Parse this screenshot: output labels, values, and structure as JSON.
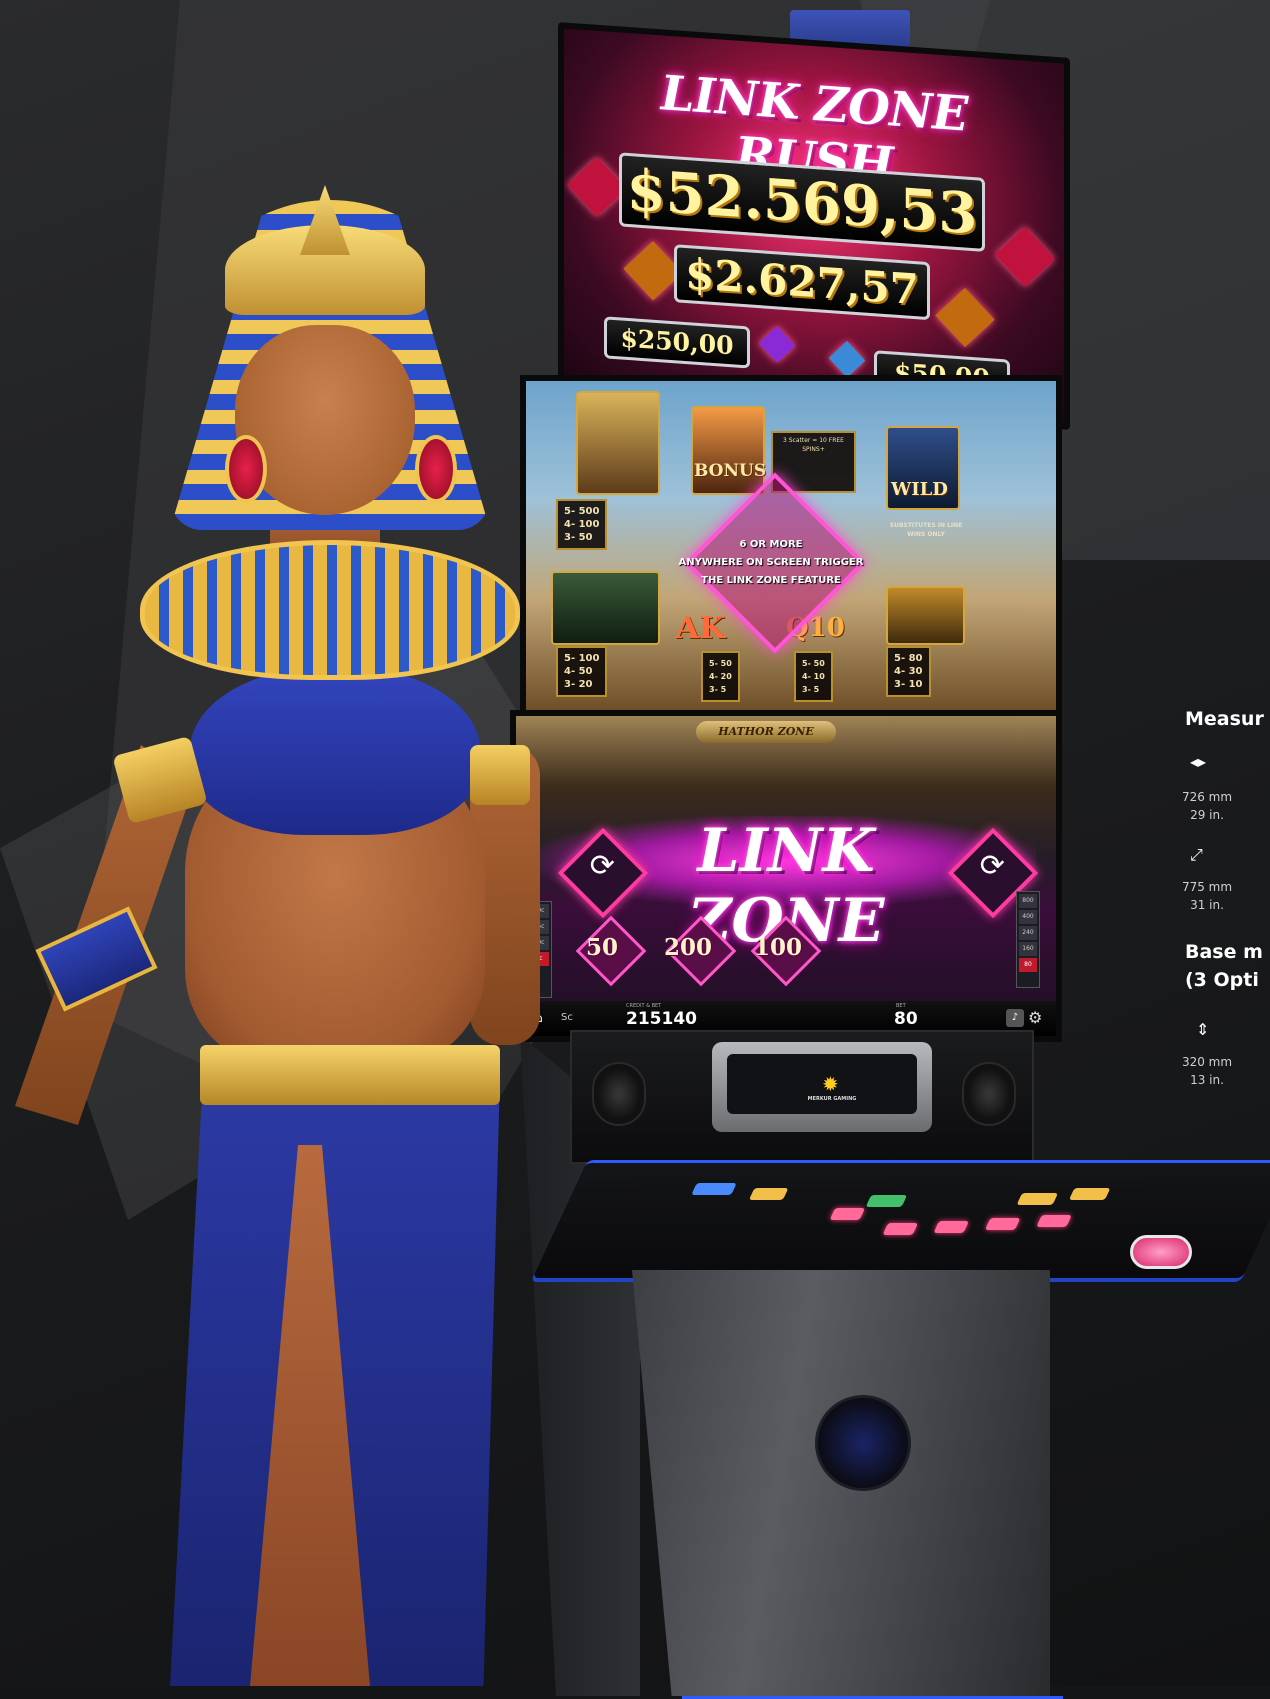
{
  "cabinet": {
    "game_title": "LINK ZONE RUSH",
    "jackpots": {
      "grand": "$52.569,53",
      "major": "$2.627,57",
      "minor": "$250,00",
      "mini": "$50,00"
    },
    "paytable": {
      "symbol_queen": [
        "5- 500",
        "4- 100",
        "3- 50"
      ],
      "symbol_anubis": [
        "5- 100",
        "4- 50",
        "3- 20"
      ],
      "symbol_ak": [
        "5- 50",
        "4- 20",
        "3- 5"
      ],
      "symbol_q10": [
        "5- 50",
        "4- 10",
        "3- 5"
      ],
      "symbol_scarab": [
        "5- 80",
        "4- 30",
        "3- 10"
      ],
      "bonus_label": "BONUS",
      "wild_label": "WILD",
      "ak_label": "AK",
      "q10_label": "Q10",
      "wild_note": "SUBSTITUTES IN LINE WINS ONLY",
      "scatter_note": "3 Scatter = 10 FREE SPINS+",
      "feature_text": [
        "6 OR MORE",
        "ANYWHERE ON SCREEN TRIGGER",
        "THE LINK ZONE FEATURE"
      ]
    },
    "main_screen": {
      "zone_header": "HATHOR ZONE",
      "banner": "LINK ZONE",
      "coin_values": [
        "50",
        "200",
        "100"
      ],
      "left_meter": [
        "50c",
        "25c",
        "10c",
        "5c"
      ],
      "right_meter": [
        "800",
        "400",
        "240",
        "160",
        "80"
      ],
      "sc_label": "Sc",
      "credit_caption": "CREDIT & BET",
      "credit": "215140",
      "bet_caption": "BET",
      "bet": "80"
    },
    "brand": {
      "name": "MERKUR GAMING"
    }
  },
  "measurements": {
    "title": "Measur",
    "width_mm": "726 mm",
    "width_in": "29 in.",
    "depth_mm": "775 mm",
    "depth_in": "31 in.",
    "base_title_line1": "Base m",
    "base_title_line2": "(3 Opti",
    "height_mm": "320 mm",
    "height_in": "13 in."
  },
  "colors": {
    "accent_blue": "#2d5bff",
    "neon_pink": "#ff3aa0",
    "gold": "#f2c04a"
  },
  "icons": {
    "width": "arrows-left-right-icon",
    "depth": "arrows-diagonal-icon",
    "height": "arrows-up-down-icon",
    "home": "home-icon",
    "settings": "gear-icon",
    "sound": "speaker-icon",
    "respin": "refresh-icon"
  }
}
